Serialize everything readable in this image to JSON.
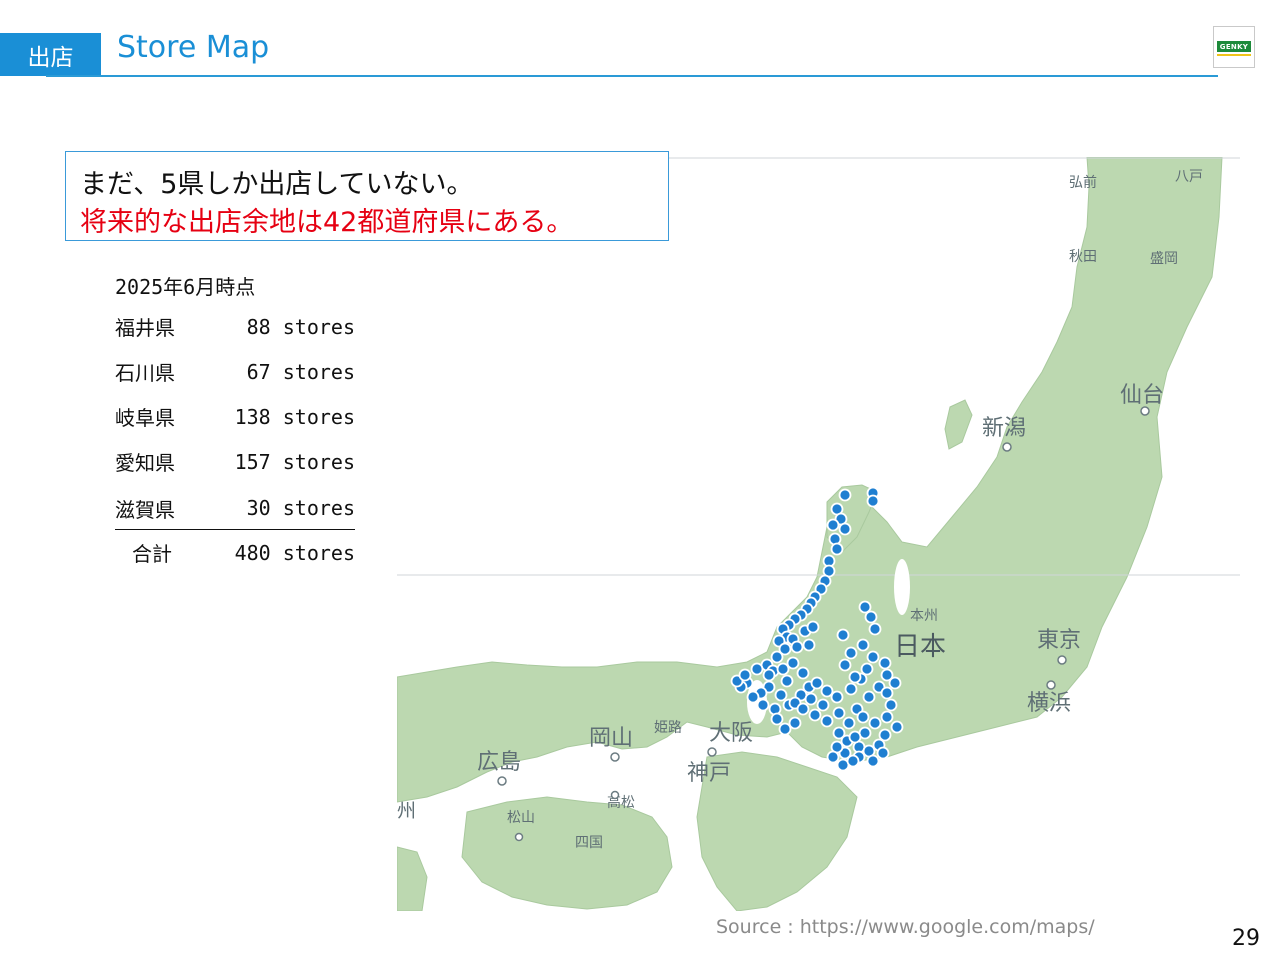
{
  "header": {
    "section_tag": "出店",
    "title": "Store Map",
    "logo_text": "GENKY"
  },
  "message": {
    "line1": "まだ、5県しか出店していない。",
    "line2": "将来的な出店余地は42都道府県にある。",
    "line2_color": "#e60012"
  },
  "stats": {
    "date": "2025年6月時点",
    "rows": [
      {
        "prefecture": "福井県",
        "count": "88 stores"
      },
      {
        "prefecture": "石川県",
        "count": "67 stores"
      },
      {
        "prefecture": "岐阜県",
        "count": "138 stores"
      },
      {
        "prefecture": "愛知県",
        "count": "157 stores"
      },
      {
        "prefecture": "滋賀県",
        "count": "30 stores"
      }
    ],
    "total": {
      "label": "合計",
      "count": "480 stores"
    }
  },
  "map": {
    "labels": {
      "hirosaki": "弘前",
      "hachinohe": "八戸",
      "akita": "秋田",
      "morioka": "盛岡",
      "sendai": "仙台",
      "niigata": "新潟",
      "honshu": "本州",
      "japan": "日本",
      "tokyo": "東京",
      "yokohama": "横浜",
      "okayama": "岡山",
      "himeji": "姫路",
      "osaka": "大阪",
      "kobe": "神戸",
      "hiroshima": "広島",
      "takamatsu": "高松",
      "matsuyama": "松山",
      "shikoku": "四国",
      "kyushu": "州"
    },
    "colors": {
      "land": "#bcd8b0",
      "sea": "#ffffff",
      "marker": "#1f7fd1"
    },
    "store_marker_icon": "map-pin-dot"
  },
  "footer": {
    "source": "Source : https://www.google.com/maps/",
    "page_number": "29"
  }
}
